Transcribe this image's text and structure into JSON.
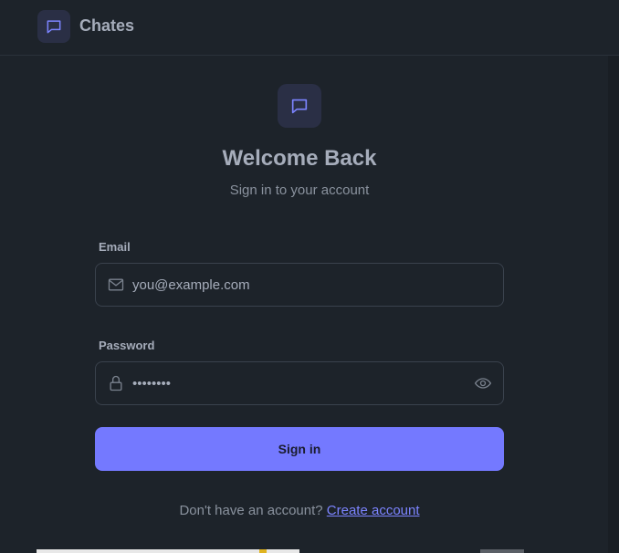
{
  "header": {
    "app_name": "Chates",
    "icon": "chat-bubble-icon"
  },
  "main": {
    "logo_icon": "chat-bubble-icon",
    "title": "Welcome Back",
    "subtitle": "Sign in to your account"
  },
  "form": {
    "email": {
      "label": "Email",
      "placeholder": "you@example.com",
      "value": "",
      "icon": "mail-icon"
    },
    "password": {
      "label": "Password",
      "value": "••••••••",
      "icon": "lock-icon",
      "toggle_icon": "eye-icon"
    },
    "submit_label": "Sign in"
  },
  "footer": {
    "prompt": "Don't have an account?",
    "link_label": "Create account"
  },
  "colors": {
    "background": "#1d232a",
    "accent": "#7479ff",
    "link": "#7c84ff"
  }
}
